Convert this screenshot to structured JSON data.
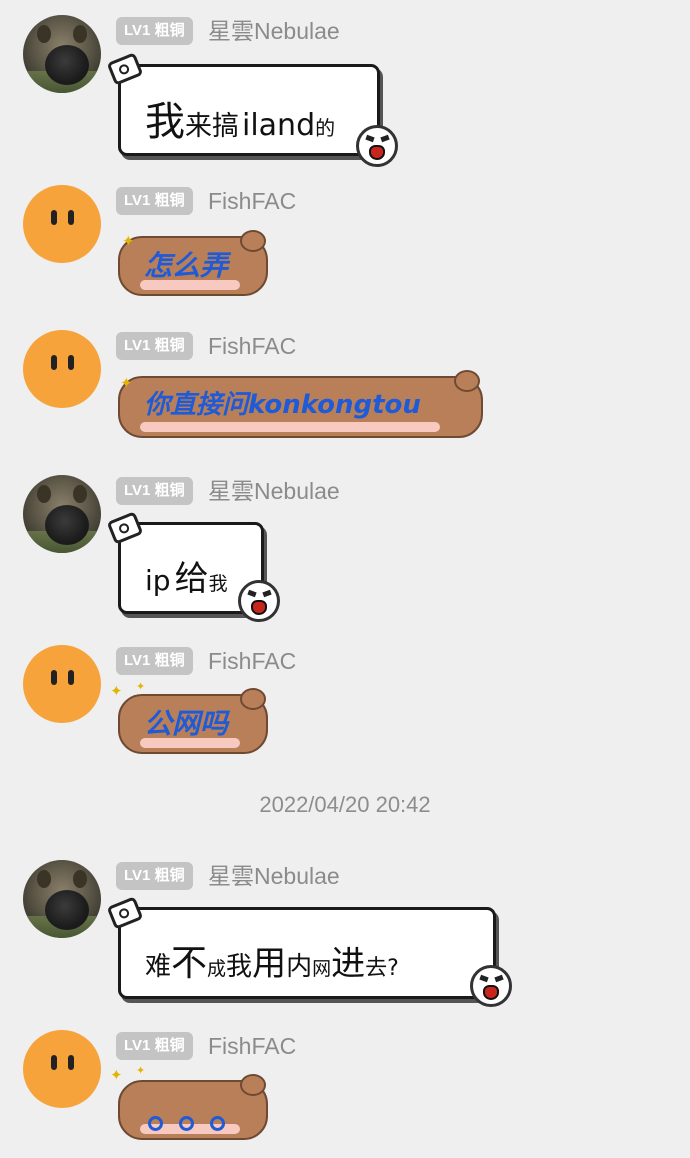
{
  "level_badge": "LV1 粗铜",
  "users": {
    "nebulae": "星雲Nebulae",
    "fishfac": "FishFAC"
  },
  "messages": [
    {
      "sender": "星雲Nebulae",
      "parts": [
        "我",
        "来搞",
        "iland",
        "的"
      ]
    },
    {
      "sender": "FishFAC",
      "text": "怎么弄"
    },
    {
      "sender": "FishFAC",
      "text": "你直接问konkongtou"
    },
    {
      "sender": "星雲Nebulae",
      "parts": [
        "ip",
        "给",
        "我"
      ]
    },
    {
      "sender": "FishFAC",
      "text": "公网吗"
    },
    {
      "sender": "星雲Nebulae",
      "parts": [
        "难",
        "不",
        "成",
        "我",
        "用",
        "内",
        "网",
        "进",
        "去?"
      ]
    },
    {
      "sender": "FishFAC",
      "text": ""
    }
  ],
  "timestamp": "2022/04/20 20:42",
  "colors": {
    "background": "#efefef",
    "bear_body": "#b97f59",
    "bear_text": "#1f5bd6",
    "avatar_fish": "#f7a33b"
  },
  "icons": [
    "film-reel-icon",
    "scream-face-icon",
    "sparkle-icon"
  ]
}
